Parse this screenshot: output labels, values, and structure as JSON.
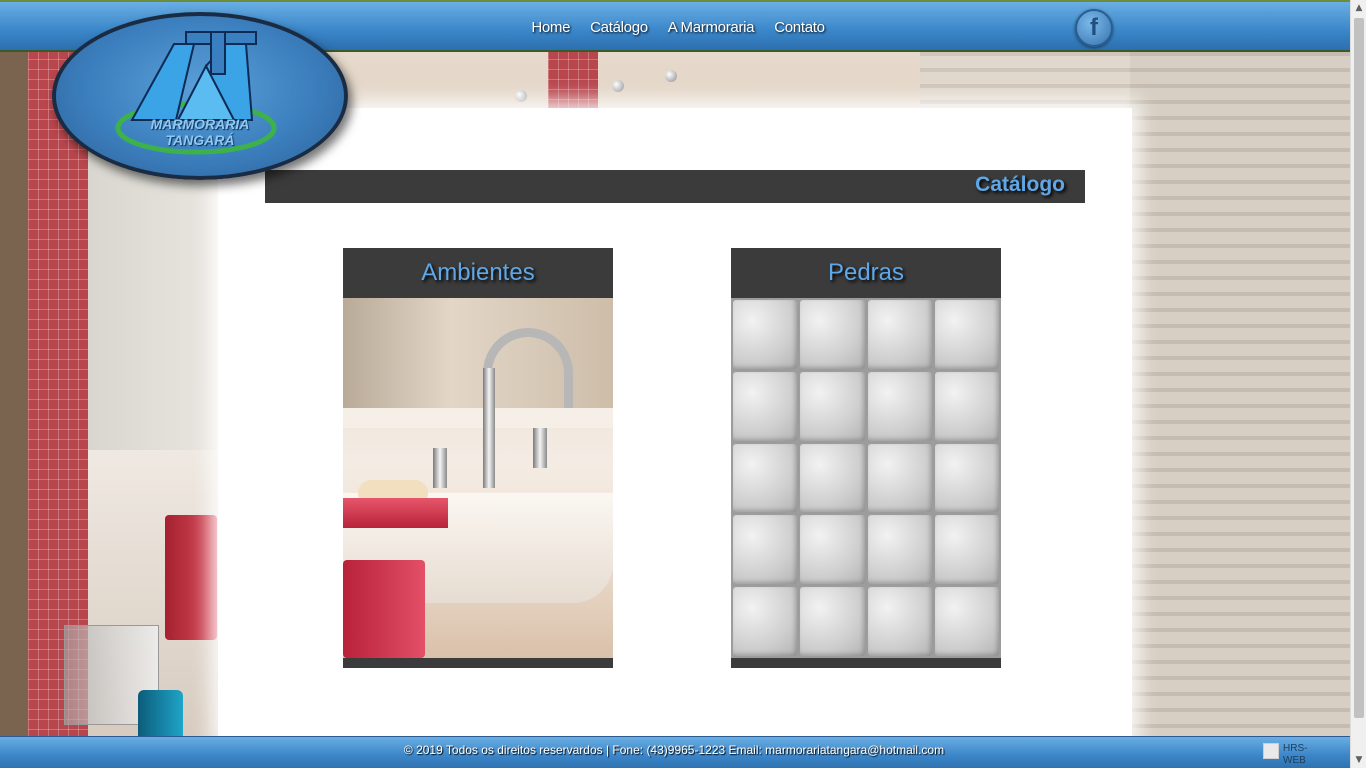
{
  "nav": {
    "items": [
      {
        "label": "Home"
      },
      {
        "label": "Catálogo"
      },
      {
        "label": "A Marmoraria"
      },
      {
        "label": "Contato"
      }
    ],
    "facebook_icon": "facebook-icon"
  },
  "logo": {
    "line1": "MARMORARIA",
    "line2": "TANGARÁ"
  },
  "main": {
    "title": "Catálogo",
    "cards": [
      {
        "title": "Ambientes",
        "image": "bathroom-sink-photo"
      },
      {
        "title": "Pedras",
        "image": "stone-tiles-photo"
      }
    ]
  },
  "footer": {
    "text": "© 2019 Todos os direitos reservardos | Fone: (43)9965-1223 Email: marmorariatangara@hotmail.com",
    "badge_alt": "HRS-WEB"
  },
  "colors": {
    "header_blue": "#3a86c9",
    "title_blue": "#5fa7e6",
    "dark_bar": "#3b3b3b"
  }
}
